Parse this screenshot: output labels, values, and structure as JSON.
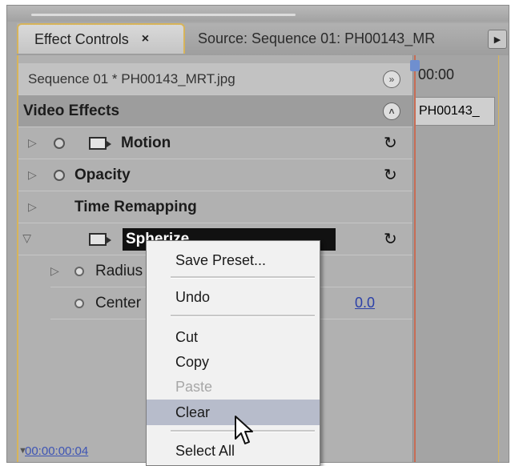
{
  "tabs": {
    "effect_controls": "Effect Controls",
    "close": "×",
    "source": "Source: Sequence 01: PH00143_MR",
    "more": "▶"
  },
  "sequence_label": "Sequence 01 * PH00143_MRT.jpg",
  "video_effects_label": "Video Effects",
  "effects": {
    "motion": "Motion",
    "opacity": "Opacity",
    "time_remapping": "Time Remapping",
    "spherize": "Spherize"
  },
  "properties": {
    "radius": "Radius",
    "center": "Center",
    "center_value_fragment": "0.0"
  },
  "timeline": {
    "time": "00:00",
    "clip": "PH00143_"
  },
  "bottom_timecode": "00:00:00:04",
  "context_menu": {
    "save_preset": "Save Preset...",
    "undo": "Undo",
    "cut": "Cut",
    "copy": "Copy",
    "paste": "Paste",
    "clear": "Clear",
    "select_all": "Select All"
  },
  "colors": {
    "panel_highlight": "#d7b45a",
    "selection": "#111111",
    "menu_hover": "#b7bccb",
    "playhead": "#c76c54",
    "link": "#2b40a8"
  }
}
